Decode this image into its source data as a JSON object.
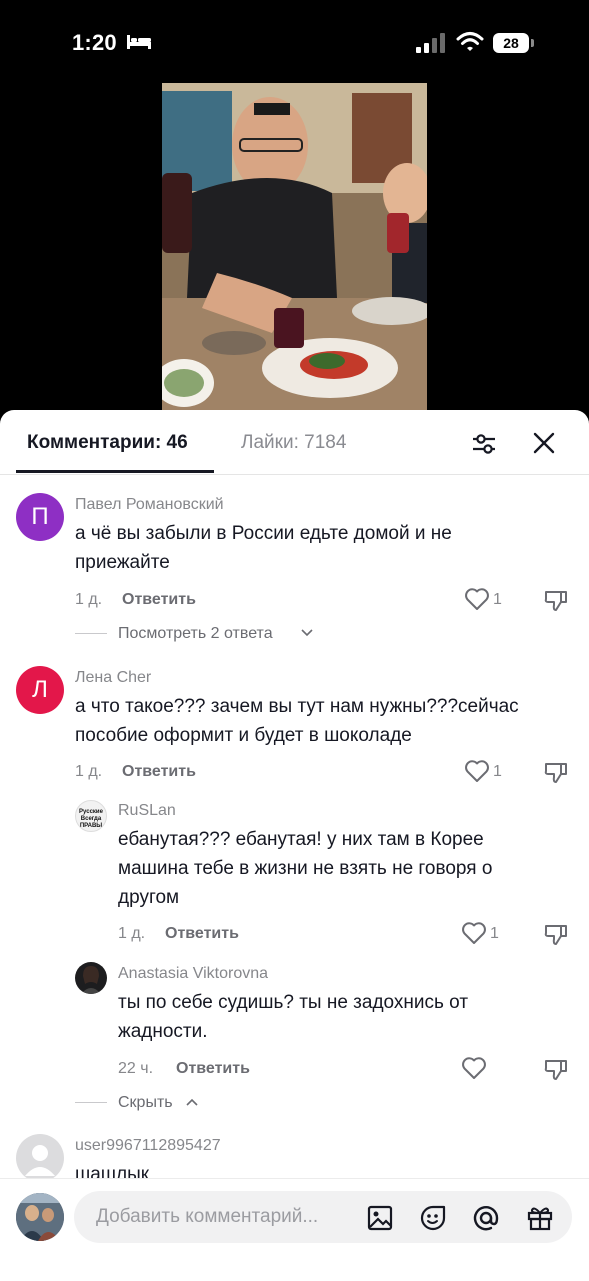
{
  "status": {
    "time": "1:20",
    "battery": "28"
  },
  "tabs": {
    "comments": "Комментарии: 46",
    "likes": "Лайки: 7184"
  },
  "comments": [
    {
      "avatar_letter": "П",
      "avatar_color": "#8e2fc4",
      "name": "Павел Романовский",
      "text_lines": [
        "а чё вы забыли в России едьте домой и не",
        "приежайте"
      ],
      "time": "1 д.",
      "reply_label": "Ответить",
      "likes": "1",
      "view_replies": "Посмотреть 2 ответа"
    },
    {
      "avatar_letter": "Л",
      "avatar_color": "#e3174a",
      "name": "Лена Cher",
      "text_lines": [
        "а что такое??? зачем вы тут нам нужны???сейчас",
        "пособие оформит и будет в шоколаде"
      ],
      "time": "1 д.",
      "reply_label": "Ответить",
      "likes": "1"
    }
  ],
  "replies": [
    {
      "avatar_text": "Русские Всегда ПРАВЫ",
      "name": "RuSLan",
      "text_lines": [
        "ебанутая??? ебанутая! у них там в Корее",
        "машина тебе в жизни не взять не говоря о",
        "другом"
      ],
      "time": "1 д.",
      "reply_label": "Ответить",
      "likes": "1"
    },
    {
      "name": "Anastasia Viktorovna",
      "text_lines": [
        "ты по себе судишь? ты не задохнись от",
        "жадности."
      ],
      "time": "22 ч.",
      "reply_label": "Ответить",
      "likes": ""
    }
  ],
  "hide_label": "Скрыть",
  "last_comment": {
    "name": "user9967112895427",
    "text": "шашлык"
  },
  "input": {
    "placeholder": "Добавить комментарий..."
  },
  "colors": {
    "accent_text": "#161823",
    "muted": "#86878b",
    "sheet_bg": "#ffffff"
  },
  "icons": [
    "bed-icon",
    "signal-icon",
    "wifi-icon",
    "battery-icon",
    "filter-icon",
    "close-icon",
    "heart-icon",
    "dislike-icon",
    "chevron-down-icon",
    "chevron-up-icon",
    "image-icon",
    "emoji-icon",
    "at-icon",
    "gift-icon"
  ]
}
